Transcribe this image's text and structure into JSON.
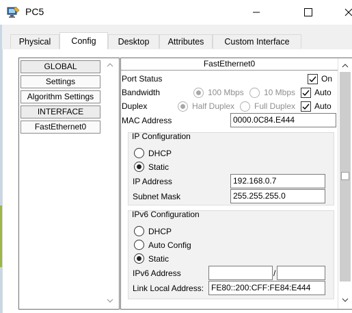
{
  "window": {
    "title": "PC5",
    "minimize_glyph": "—",
    "maximize_glyph": "☐",
    "close_glyph": "✕"
  },
  "tabs": [
    "Physical",
    "Config",
    "Desktop",
    "Attributes",
    "Custom Interface"
  ],
  "active_tab": "Config",
  "sidebar": {
    "items": [
      "GLOBAL",
      "Settings",
      "Algorithm Settings",
      "INTERFACE",
      "FastEthernet0"
    ]
  },
  "interface": {
    "title": "FastEthernet0",
    "port_status_label": "Port Status",
    "port_on_label": "On",
    "bandwidth_label": "Bandwidth",
    "bw_100": "100 Mbps",
    "bw_10": "10 Mbps",
    "bw_auto": "Auto",
    "duplex_label": "Duplex",
    "half_duplex": "Half Duplex",
    "full_duplex": "Full Duplex",
    "duplex_auto": "Auto",
    "mac_label": "MAC Address",
    "mac_value": "0000.0C84.E444"
  },
  "ip_config": {
    "title": "IP Configuration",
    "dhcp": "DHCP",
    "static": "Static",
    "ip_label": "IP Address",
    "ip_value": "192.168.0.7",
    "mask_label": "Subnet Mask",
    "mask_value": "255.255.255.0"
  },
  "ipv6_config": {
    "title": "IPv6 Configuration",
    "dhcp": "DHCP",
    "auto": "Auto Config",
    "static": "Static",
    "addr_label": "IPv6 Address",
    "addr_value": "",
    "prefix_value": "",
    "separator": "/",
    "link_label": "Link Local Address:",
    "link_value": "FE80::200:CFF:FE84:E444"
  },
  "colors": {
    "accent": "#000000",
    "group_bg": "#f2f2f2",
    "disabled_text": "#8f8f8f"
  }
}
